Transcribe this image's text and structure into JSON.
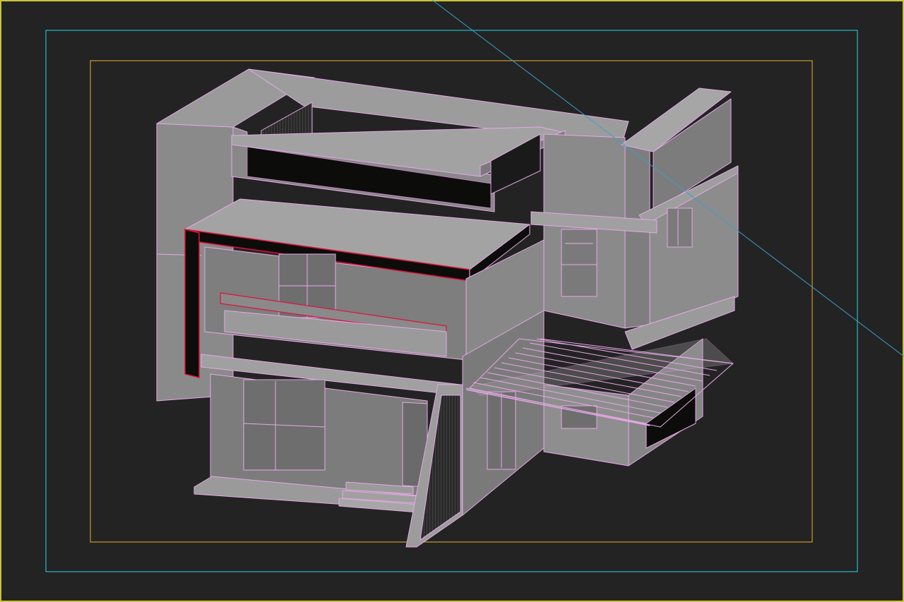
{
  "viewport": {
    "colors": {
      "background": "#232323",
      "viewport_border": "#c9c23a",
      "safe_frame_outer": "#26b8c8",
      "safe_frame_inner": "#c99a2a",
      "camera_line": "#3aa0c8",
      "face_light": "#8e8e8e",
      "face_mid": "#7a7a7a",
      "face_dark": "#6a6a6a",
      "wire": "#e6a8e6",
      "selection_edge": "#e0103c",
      "void": "#0c0c0a"
    }
  }
}
